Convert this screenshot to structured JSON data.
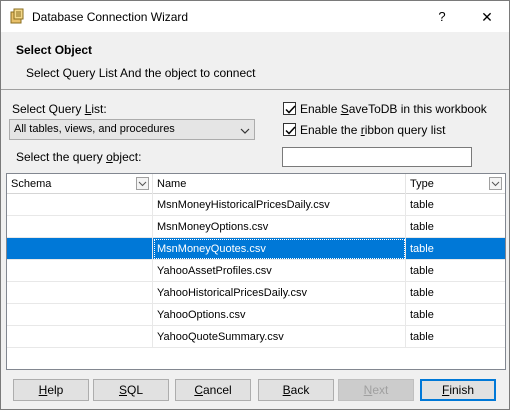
{
  "window": {
    "title": "Database Connection Wizard",
    "help_glyph": "?",
    "close_glyph": "✕"
  },
  "header": {
    "title": "Select Object",
    "subtitle": "Select Query List And the object to connect"
  },
  "form": {
    "query_list_label_pre": "Select Query ",
    "query_list_label_u": "L",
    "query_list_label_post": "ist:",
    "query_list_value": "All tables, views, and procedures",
    "savetodb_pre": "Enable ",
    "savetodb_u": "S",
    "savetodb_post": "aveToDB in this workbook",
    "savetodb_checked": true,
    "ribbon_pre": "Enable the ",
    "ribbon_u": "r",
    "ribbon_post": "ibbon query list",
    "ribbon_checked": true,
    "query_object_pre": "Select the query ",
    "query_object_u": "o",
    "query_object_post": "bject:",
    "search_value": ""
  },
  "grid": {
    "columns": [
      "Schema",
      "Name",
      "Type"
    ],
    "rows": [
      {
        "schema": "",
        "name": "MsnMoneyHistoricalPricesDaily.csv",
        "type": "table",
        "selected": false
      },
      {
        "schema": "",
        "name": "MsnMoneyOptions.csv",
        "type": "table",
        "selected": false
      },
      {
        "schema": "",
        "name": "MsnMoneyQuotes.csv",
        "type": "table",
        "selected": true
      },
      {
        "schema": "",
        "name": "YahooAssetProfiles.csv",
        "type": "table",
        "selected": false
      },
      {
        "schema": "",
        "name": "YahooHistoricalPricesDaily.csv",
        "type": "table",
        "selected": false
      },
      {
        "schema": "",
        "name": "YahooOptions.csv",
        "type": "table",
        "selected": false
      },
      {
        "schema": "",
        "name": "YahooQuoteSummary.csv",
        "type": "table",
        "selected": false
      }
    ]
  },
  "buttons": {
    "help_u": "H",
    "help_post": "elp",
    "sql_u": "S",
    "sql_post": "QL",
    "cancel_pre": "",
    "cancel_u": "C",
    "cancel_post": "ancel",
    "back_u": "B",
    "back_post": "ack",
    "next_u": "N",
    "next_post": "ext",
    "finish_u": "F",
    "finish_post": "inish"
  },
  "colors": {
    "accent": "#0078d7",
    "selection_bg": "#0078d7"
  }
}
